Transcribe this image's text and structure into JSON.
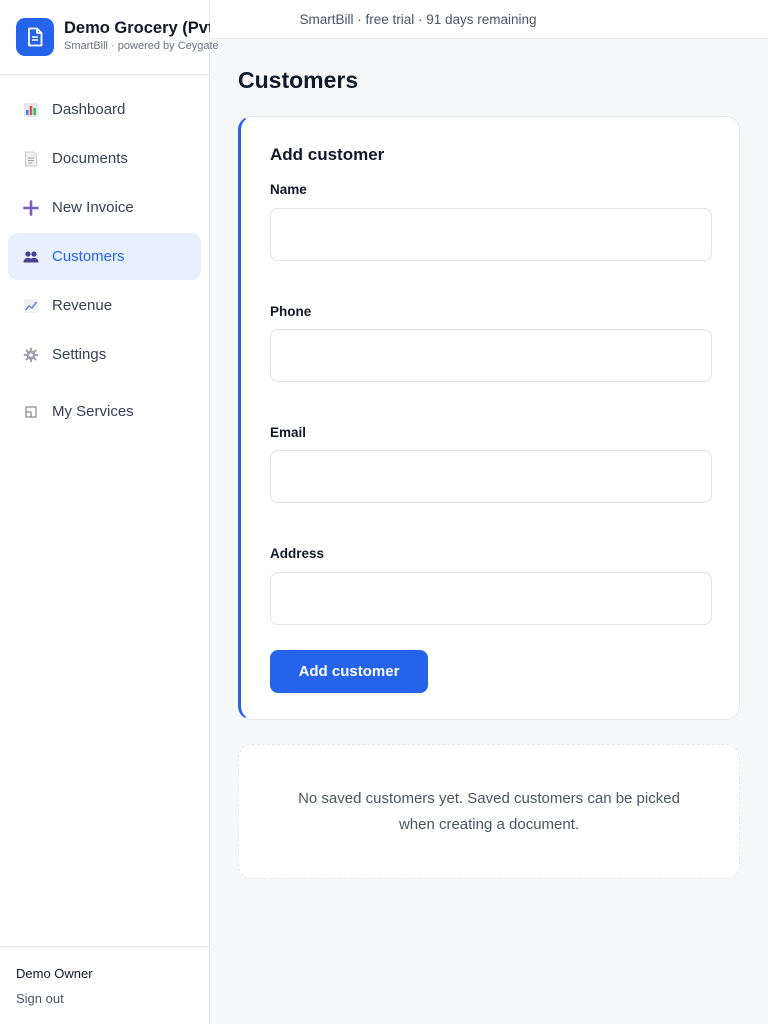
{
  "brand": {
    "name": "Demo Grocery (Pvt) Ltd",
    "subtitle": "SmartBill · powered by Ceygate",
    "logo_icon": "document-icon",
    "color": "#2563eb"
  },
  "topbar": {
    "trial_text": "SmartBill · free trial · 91 days remaining"
  },
  "sidebar": {
    "items": [
      {
        "label": "Dashboard",
        "icon": "bar-chart-icon"
      },
      {
        "label": "Documents",
        "icon": "document-icon"
      },
      {
        "label": "New Invoice",
        "icon": "plus-icon"
      },
      {
        "label": "Customers",
        "icon": "users-icon",
        "active": true
      },
      {
        "label": "Revenue",
        "icon": "line-chart-icon"
      },
      {
        "label": "Settings",
        "icon": "gear-icon"
      },
      {
        "label": "My Services",
        "icon": "window-icon"
      }
    ],
    "footer": {
      "owner": "Demo Owner",
      "signout": "Sign out"
    }
  },
  "main": {
    "title": "Customers",
    "form": {
      "title": "Add customer",
      "fields": [
        {
          "label": "Name",
          "value": "",
          "placeholder": ""
        },
        {
          "label": "Phone",
          "value": "",
          "placeholder": ""
        },
        {
          "label": "Email",
          "value": "",
          "placeholder": ""
        },
        {
          "label": "Address",
          "value": "",
          "placeholder": ""
        }
      ],
      "submit_label": "Add customer"
    },
    "empty_message": "No saved customers yet. Saved customers can be picked when creating a document."
  },
  "colors": {
    "accent": "#2563eb",
    "active_bg": "#e8efff"
  }
}
